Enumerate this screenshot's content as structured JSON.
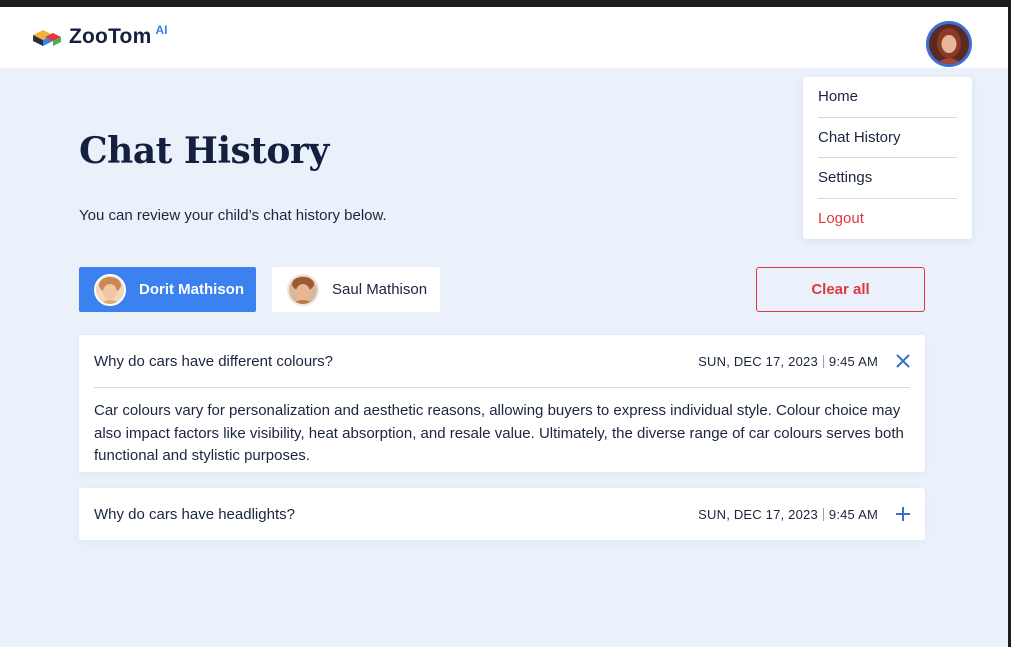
{
  "brand": {
    "name": "ZooTom",
    "sup": "AI"
  },
  "profile": {
    "avatar_icon": "user-avatar"
  },
  "menu": {
    "items": [
      {
        "label": "Home"
      },
      {
        "label": "Chat History"
      },
      {
        "label": "Settings"
      },
      {
        "label": "Logout"
      }
    ]
  },
  "page": {
    "title": "Chat History",
    "subtitle": "You can review your child’s chat history below."
  },
  "children": [
    {
      "name": "Dorit Mathison",
      "active": true
    },
    {
      "name": "Saul Mathison",
      "active": false
    }
  ],
  "actions": {
    "clear_all": "Clear all"
  },
  "chats": [
    {
      "question": "Why do cars have different colours?",
      "date": "SUN, DEC 17, 2023",
      "time": "9:45 AM",
      "expanded": true,
      "answer": "Car colours vary for personalization and aesthetic reasons, allowing buyers to express individual style. Colour choice may also impact factors like visibility, heat absorption, and resale value. Ultimately, the diverse range of car colours serves both functional and stylistic purposes."
    },
    {
      "question": "Why do cars have headlights?",
      "date": "SUN, DEC 17, 2023",
      "time": "9:45 AM",
      "expanded": false
    }
  ],
  "colors": {
    "accent": "#3b82f0",
    "danger": "#e0383e",
    "background": "#eaf1fb",
    "text": "#1b2540"
  }
}
